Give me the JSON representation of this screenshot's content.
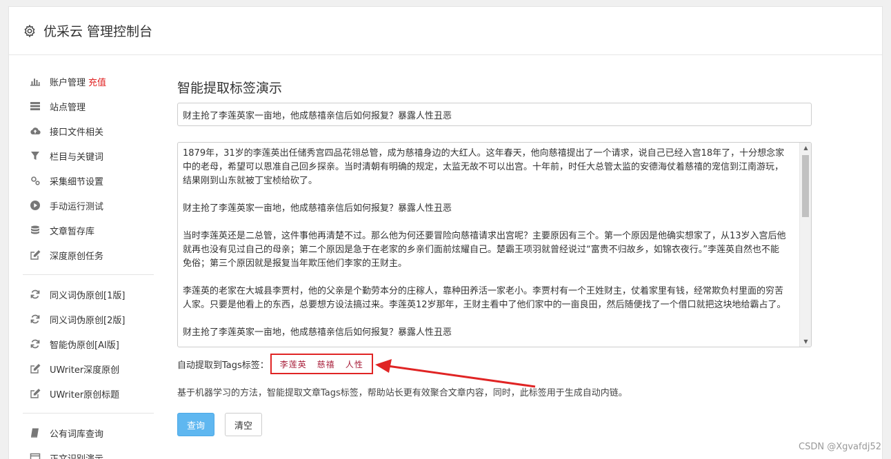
{
  "header": {
    "title": "优采云 管理控制台"
  },
  "sidebar": {
    "group1": [
      {
        "label": "账户管理",
        "icon": "bar-chart-icon",
        "badge": "充值"
      },
      {
        "label": "站点管理",
        "icon": "server-icon"
      },
      {
        "label": "接口文件相关",
        "icon": "cloud-upload-icon"
      },
      {
        "label": "栏目与关键词",
        "icon": "filter-icon"
      },
      {
        "label": "采集细节设置",
        "icon": "cogs-icon"
      },
      {
        "label": "手动运行测试",
        "icon": "play-circle-icon"
      },
      {
        "label": "文章暂存库",
        "icon": "database-icon"
      },
      {
        "label": "深度原创任务",
        "icon": "edit-icon"
      }
    ],
    "group2": [
      {
        "label": "同义词伪原创[1版]",
        "icon": "refresh-icon"
      },
      {
        "label": "同义词伪原创[2版]",
        "icon": "refresh-icon"
      },
      {
        "label": "智能伪原创[AI版]",
        "icon": "refresh-icon"
      },
      {
        "label": "UWriter深度原创",
        "icon": "edit-icon"
      },
      {
        "label": "UWriter原创标题",
        "icon": "edit-icon"
      }
    ],
    "group3": [
      {
        "label": "公有词库查询",
        "icon": "book-icon"
      },
      {
        "label": "正文识别演示",
        "icon": "window-icon"
      }
    ]
  },
  "main": {
    "page_title": "智能提取标签演示",
    "title_value": "财主抢了李莲英家一亩地，他成慈禧亲信后如何报复？暴露人性丑恶",
    "content_paragraphs": [
      "1879年，31岁的李莲英出任储秀宫四品花翎总管，成为慈禧身边的大红人。这年春天，他向慈禧提出了一个请求，说自己已经入宫18年了，十分想念家中的老母，希望可以恩准自己回乡探亲。当时清朝有明确的规定，太监无故不可以出宫。十年前，时任大总管太监的安德海仗着慈禧的宠信到江南游玩，结果刚到山东就被丁宝桢给砍了。",
      "财主抢了李莲英家一亩地，他成慈禧亲信后如何报复？暴露人性丑恶",
      "当时李莲英还是二总管，这件事他再清楚不过。那么他为何还要冒险向慈禧请求出宫呢？主要原因有三个。第一个原因是他确实想家了，从13岁入宫后他就再也没有见过自己的母亲；第二个原因是急于在老家的乡亲们面前炫耀自己。楚霸王项羽就曾经说过“富贵不归故乡，如锦衣夜行。”李莲英自然也不能免俗；第三个原因就是报复当年欺压他们李家的王财主。",
      "李莲英的老家在大城县李贾村，他的父亲是个勤劳本分的庄稼人，靠种田养活一家老小。李贾村有一个王姓财主，仗着家里有钱，经常欺负村里面的穷苦人家。只要是他看上的东西，总要想方设法搞过来。李莲英12岁那年，王财主看中了他们家中的一亩良田，然后随便找了一个借口就把这块地给霸占了。",
      "财主抢了李莲英家一亩地，他成慈禧亲信后如何报复？暴露人性丑恶"
    ],
    "tags_label": "自动提取到Tags标签：",
    "tags": [
      "李莲英",
      "慈禧",
      "人性"
    ],
    "description": "基于机器学习的方法，智能提取文章Tags标签，帮助站长更有效聚合文章内容，同时，此标签用于生成自动内链。",
    "query_button": "查询",
    "clear_button": "清空"
  },
  "watermark": "CSDN @Xgvafdj52",
  "colors": {
    "primary": "#5fb7f0",
    "highlight_border": "#e02424",
    "tag_text": "#a8203b",
    "badge": "#e02020"
  }
}
